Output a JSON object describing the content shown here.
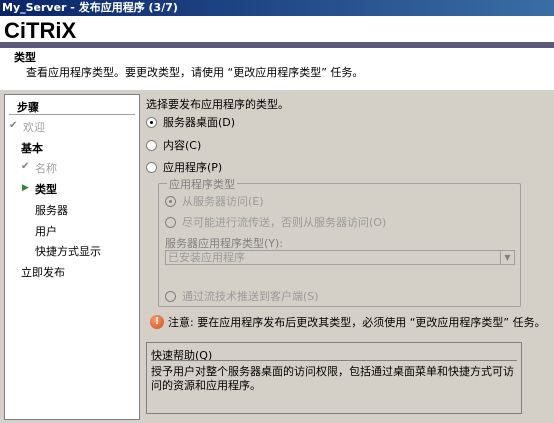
{
  "window": {
    "title": "My_Server - 发布应用程序 (3/7)"
  },
  "logo": {
    "text": "CiTRiX",
    "dot": "·"
  },
  "header": {
    "title": "类型",
    "description": "查看应用程序类型。要更改类型，请使用 “更改应用程序类型” 任务。"
  },
  "sidebar": {
    "heading": "步骤",
    "items": [
      {
        "label": "欢迎",
        "state": "done"
      },
      {
        "label": "基本",
        "state": "section"
      },
      {
        "label": "名称",
        "state": "done"
      },
      {
        "label": "类型",
        "state": "current"
      },
      {
        "label": "服务器",
        "state": "normal"
      },
      {
        "label": "用户",
        "state": "normal"
      },
      {
        "label": "快捷方式显示",
        "state": "normal"
      },
      {
        "label": "立即发布",
        "state": "section"
      }
    ]
  },
  "main": {
    "instruction": "选择要发布应用程序的类型。",
    "options": {
      "server_desktop": "服务器桌面(D)",
      "content": "内容(C)",
      "application": "应用程序(P)"
    },
    "group": {
      "legend": "应用程序类型",
      "access_from_server": "从服务器访问(E)",
      "stream_if_possible": "尽可能进行流传送，否则从服务器访问(O)",
      "server_app_type_label": "服务器应用程序类型(Y):",
      "server_app_type_value": "已安装应用程序",
      "stream_to_client": "通过流技术推送到客户端(S)"
    },
    "note": "注意: 要在应用程序发布后更改其类型，必须使用 “更改应用程序类型” 任务。",
    "help": {
      "title": "快速帮助(Q)",
      "text": "授予用户对整个服务器桌面的访问权限，包括通过桌面菜单和快捷方式可访问的资源和应用程序。"
    }
  },
  "icons": {
    "check": "check-icon",
    "arrow": "current-step-arrow-icon",
    "warning": "warning-icon",
    "dropdown": "chevron-down-icon"
  }
}
